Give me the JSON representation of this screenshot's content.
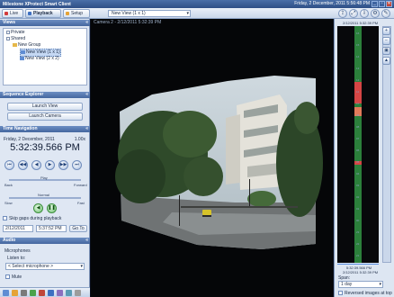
{
  "window": {
    "title": "Milestone XProtect Smart Client",
    "datetime": "Friday, 2 December, 2011    5:56:48 PM",
    "min": "_",
    "max": "▫",
    "close": "✕"
  },
  "toolbar": {
    "tabs": [
      {
        "label": "Live"
      },
      {
        "label": "Playback"
      },
      {
        "label": "Setup"
      }
    ],
    "view_select": "New View (1 x 1)"
  },
  "views": {
    "header": "Views",
    "items": [
      {
        "label": "Private"
      },
      {
        "label": "Shared"
      },
      {
        "label": "New Group"
      },
      {
        "label": "New View (1 x 1)"
      },
      {
        "label": "New View (2 x 2)"
      }
    ]
  },
  "sequence": {
    "header": "Sequence Explorer",
    "launch_view": "Launch View",
    "launch_camera": "Launch Camera"
  },
  "time_nav": {
    "header": "Time Navigation",
    "date": "Friday, 2 December, 2011",
    "speed": "1.00x",
    "time": "5:32:39.566 PM",
    "slider1": {
      "left": "Back",
      "center": "Play",
      "right": "Forward"
    },
    "slider2": {
      "left": "Slow",
      "center": "Normal",
      "right": "Fast"
    },
    "skip_gaps": "Skip gaps during playback",
    "date_field": "2/12/2011",
    "time_field": "5:37:52 PM",
    "go_to": "Go To"
  },
  "audio": {
    "header": "Audio",
    "microphones": "Microphones",
    "listen_to": "Listen to:",
    "mic_select": "< Select microphone >",
    "mute": "Mute"
  },
  "video": {
    "camera_label": "Camera 2 - 2/12/2011 5:32:39 PM"
  },
  "timeline": {
    "top_label": "2/12/2011 5:32:39 PM",
    "bottom_label": "2/12/2011 5:32:39 PM",
    "clock": "5:32:39.566 PM",
    "span_label": "Span:",
    "span_value": "1 day",
    "reversed": "Reversed images at top",
    "hour_labels": [
      "16",
      "15",
      "14",
      "13",
      "12",
      "11",
      "10",
      "09",
      "08",
      "07",
      "06",
      "05",
      "04",
      "03",
      "02",
      "01",
      "00",
      "23",
      "22",
      "21"
    ]
  },
  "colors": {
    "accent": "#45679f",
    "timeline_green": "#2b7f3b",
    "timeline_red": "#d64545"
  }
}
